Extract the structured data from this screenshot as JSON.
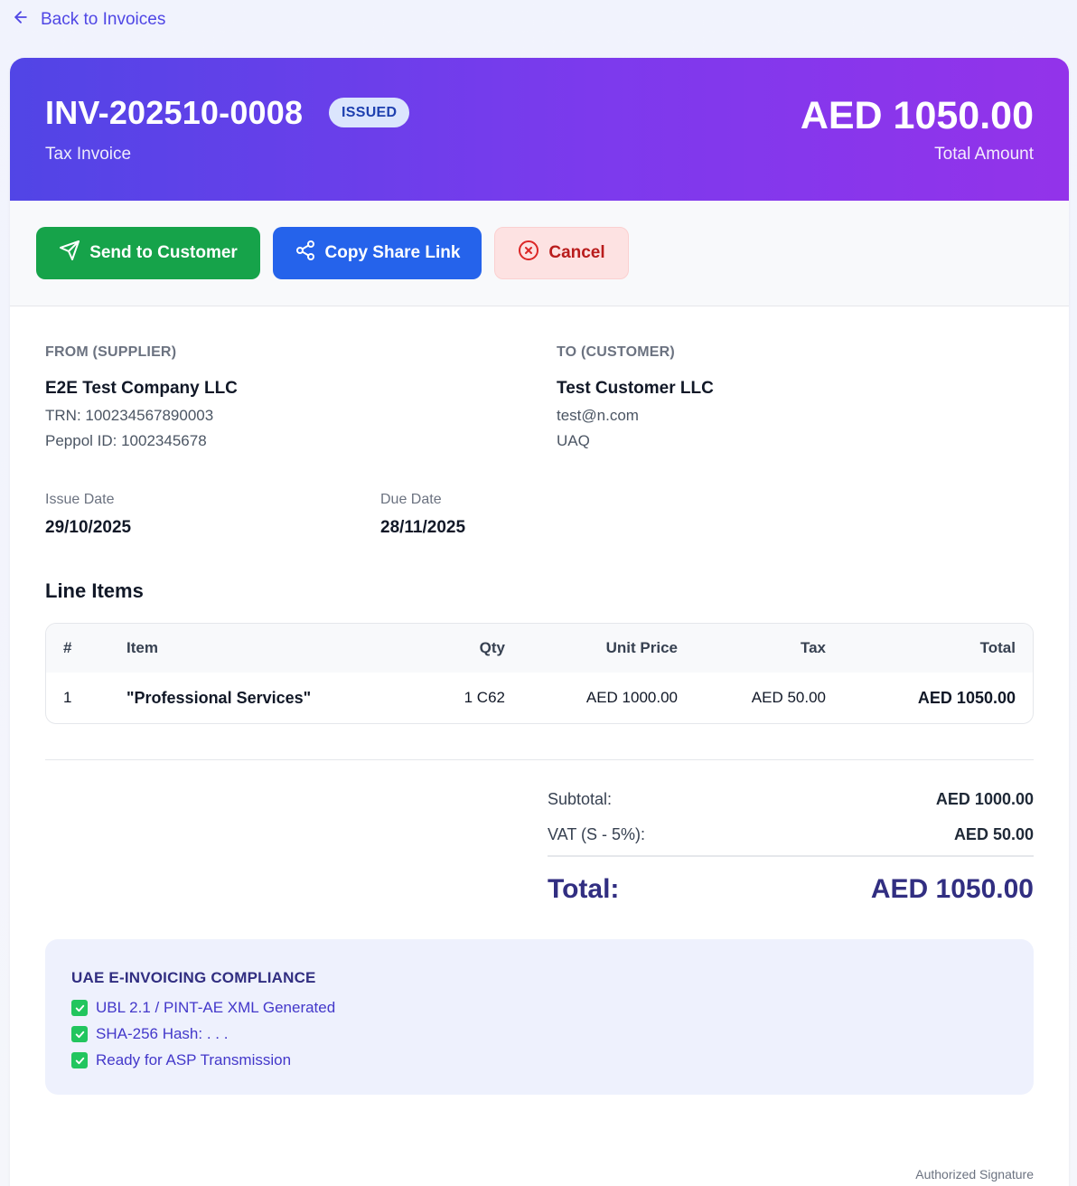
{
  "nav": {
    "back_label": "Back to Invoices"
  },
  "header": {
    "invoice_number": "INV-202510-0008",
    "status": "ISSUED",
    "doc_type": "Tax Invoice",
    "total_amount": "AED 1050.00",
    "total_caption": "Total Amount"
  },
  "actions": {
    "send_label": "Send to Customer",
    "copy_label": "Copy Share Link",
    "cancel_label": "Cancel"
  },
  "supplier": {
    "label": "FROM (SUPPLIER)",
    "name": "E2E Test Company LLC",
    "trn": "TRN: 100234567890003",
    "peppol": "Peppol ID: 1002345678"
  },
  "customer": {
    "label": "TO (CUSTOMER)",
    "name": "Test Customer LLC",
    "email": "test@n.com",
    "emirate": "UAQ"
  },
  "dates": {
    "issue_label": "Issue Date",
    "issue_value": "29/10/2025",
    "due_label": "Due Date",
    "due_value": "28/11/2025"
  },
  "line_items": {
    "title": "Line Items",
    "columns": [
      "#",
      "Item",
      "Qty",
      "Unit Price",
      "Tax",
      "Total"
    ],
    "rows": [
      [
        "1",
        "\"Professional Services\"",
        "1 C62",
        "AED 1000.00",
        "AED 50.00",
        "AED 1050.00"
      ]
    ]
  },
  "summary": {
    "subtotal_label": "Subtotal:",
    "subtotal_value": "AED 1000.00",
    "vat_label": "VAT (S - 5%):",
    "vat_value": "AED 50.00",
    "total_label": "Total:",
    "total_value": "AED 1050.00"
  },
  "compliance": {
    "title": "UAE E-INVOICING COMPLIANCE",
    "items": [
      "UBL 2.1 / PINT-AE XML Generated",
      "SHA-256 Hash: . . .",
      "Ready for ASP Transmission"
    ]
  },
  "footer": {
    "signature_label": "Authorized Signature"
  },
  "colors": {
    "accent": "#4f46e5",
    "header_gradient_start": "#5145e6",
    "header_gradient_end": "#9333ea",
    "send_button": "#16a34a",
    "copy_button": "#2563eb",
    "cancel_button_bg": "#fde2e2",
    "cancel_button_text": "#b91c1c",
    "check": "#22c55e"
  },
  "icons": {
    "back": "arrow-left-icon",
    "send": "send-icon",
    "copy": "share-icon",
    "cancel": "x-circle-icon",
    "check": "check-box-icon"
  }
}
